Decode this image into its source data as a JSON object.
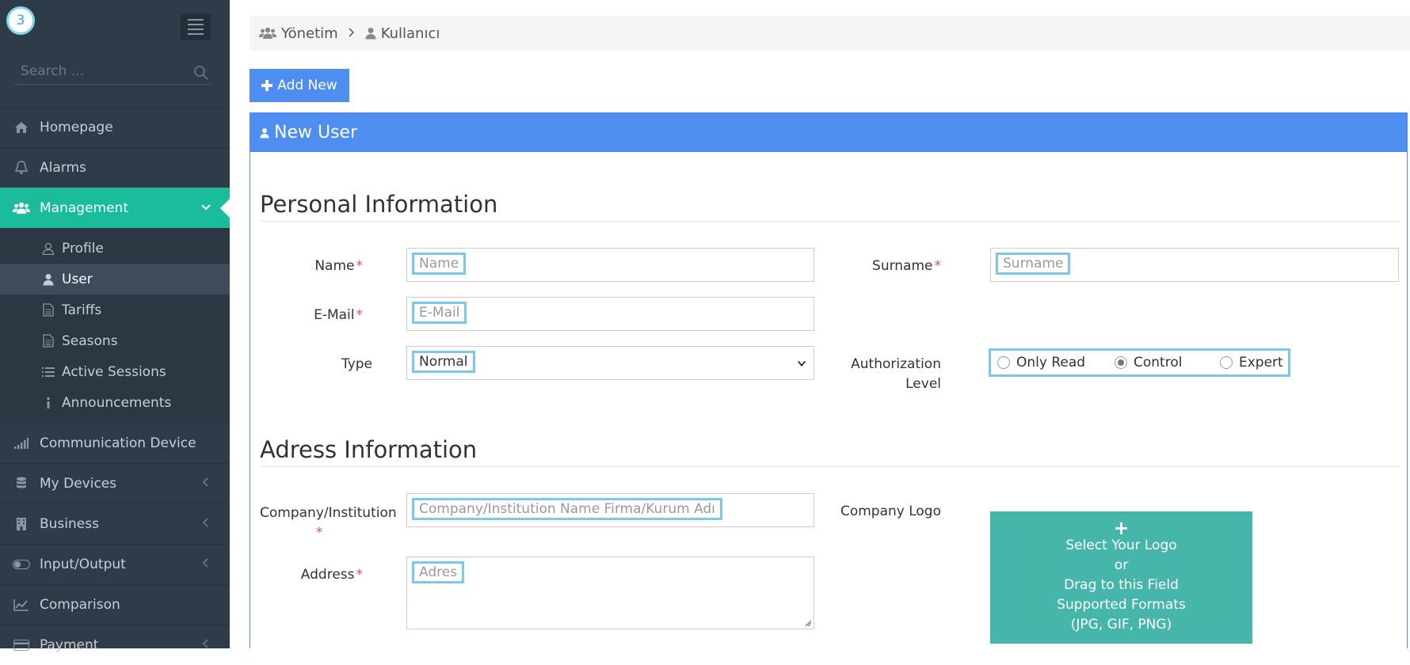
{
  "sidebar": {
    "logo_number": "3",
    "search_placeholder": "Search ...",
    "items": [
      {
        "label": "Homepage",
        "icon": "home-icon"
      },
      {
        "label": "Alarms",
        "icon": "bell-icon"
      },
      {
        "label": "Management",
        "icon": "users-icon",
        "active": true
      },
      {
        "label": "Communication Device",
        "icon": "signal-icon"
      },
      {
        "label": "My Devices",
        "icon": "database-icon"
      },
      {
        "label": "Business",
        "icon": "building-icon"
      },
      {
        "label": "Input/Output",
        "icon": "toggle-icon"
      },
      {
        "label": "Comparison",
        "icon": "line-chart-icon"
      },
      {
        "label": "Payment",
        "icon": "payment-icon"
      }
    ],
    "submenu": [
      {
        "label": "Profile",
        "icon": "user-outline-icon"
      },
      {
        "label": "User",
        "icon": "user-icon",
        "active": true
      },
      {
        "label": "Tariffs",
        "icon": "file-icon"
      },
      {
        "label": "Seasons",
        "icon": "file-icon"
      },
      {
        "label": "Active Sessions",
        "icon": "list-icon"
      },
      {
        "label": "Announcements",
        "icon": "info-icon"
      }
    ]
  },
  "breadcrumb": {
    "items": [
      "Yönetim",
      "Kullanıcı"
    ]
  },
  "toolbar": {
    "add_label": "Add New"
  },
  "panel": {
    "title": "New User"
  },
  "personal": {
    "title": "Personal Information",
    "name_label": "Name",
    "name_placeholder": "Name",
    "surname_label": "Surname",
    "surname_placeholder": "Surname",
    "email_label": "E-Mail",
    "email_placeholder": "E-Mail",
    "type_label": "Type",
    "type_value": "Normal",
    "auth_label_line1": "Authorization",
    "auth_label_line2": "Level",
    "auth_options": [
      "Only Read",
      "Control",
      "Expert"
    ],
    "auth_selected": "Control",
    "required_mark": "*"
  },
  "address": {
    "title": "Adress Information",
    "company_label": "Company/Institution",
    "company_placeholder": "Company/Institution Name Firma/Kurum Adı",
    "address_label": "Address",
    "address_placeholder": "Adres",
    "logo_label": "Company Logo",
    "logo_plus": "+",
    "logo_lines": [
      "Select Your Logo",
      "or",
      "Drag to this Field",
      "Supported Formats",
      "(JPG, GIF, PNG)"
    ]
  },
  "colors": {
    "sidebar_bg": "#2e3b48",
    "active_nav": "#1abc9c",
    "primary": "#4d8ef0",
    "logo_drop": "#45b6a9",
    "required": "#d9534f"
  }
}
